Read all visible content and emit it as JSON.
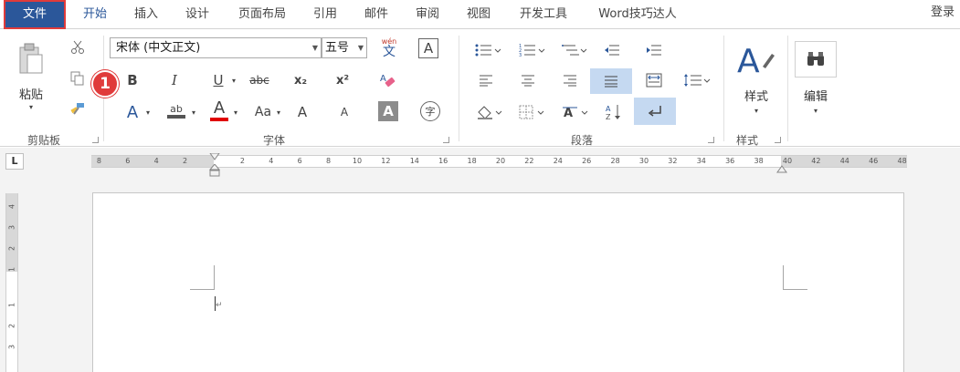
{
  "tabs": {
    "file": "文件",
    "home": "开始",
    "insert": "插入",
    "design": "设计",
    "layout": "页面布局",
    "references": "引用",
    "mailings": "邮件",
    "review": "审阅",
    "view": "视图",
    "developer": "开发工具",
    "word_tips": "Word技巧达人"
  },
  "login": "登录",
  "clipboard": {
    "paste_label": "粘贴",
    "group_label": "剪贴板"
  },
  "font": {
    "font_name": "宋体 (中文正文)",
    "font_size": "五号",
    "group_label": "字体",
    "bold": "B",
    "italic": "I",
    "underline": "U",
    "strikethrough": "abc",
    "subscript": "x₂",
    "superscript": "x²",
    "phonetic_top": "wén",
    "phonetic_bottom": "文",
    "char_border": "A",
    "text_effects": "A",
    "highlight": "ab",
    "font_color": "A",
    "change_case": "Aa",
    "grow": "A",
    "shrink": "A",
    "char_shading": "A",
    "enclose": "字"
  },
  "paragraph": {
    "group_label": "段落"
  },
  "styles": {
    "label": "样式",
    "group_label": "样式"
  },
  "editing": {
    "label": "编辑"
  },
  "callout_number": "1",
  "ruler": {
    "tab_selector": "L",
    "labels_left": [
      "8",
      "6",
      "4",
      "2"
    ],
    "labels_right": [
      "2",
      "4",
      "6",
      "8",
      "10",
      "12",
      "14",
      "16",
      "18",
      "20",
      "22",
      "24",
      "26",
      "28",
      "30",
      "32",
      "34",
      "36",
      "38",
      "40",
      "42",
      "44",
      "46",
      "48"
    ],
    "vertical_labels": [
      "4",
      "3",
      "2",
      "1",
      "1",
      "2",
      "3"
    ]
  },
  "colors": {
    "file_tab": "#2b579a",
    "accent": "#2b579a",
    "callout": "#e03b3b",
    "highlight_button": "#c5d9f1"
  }
}
